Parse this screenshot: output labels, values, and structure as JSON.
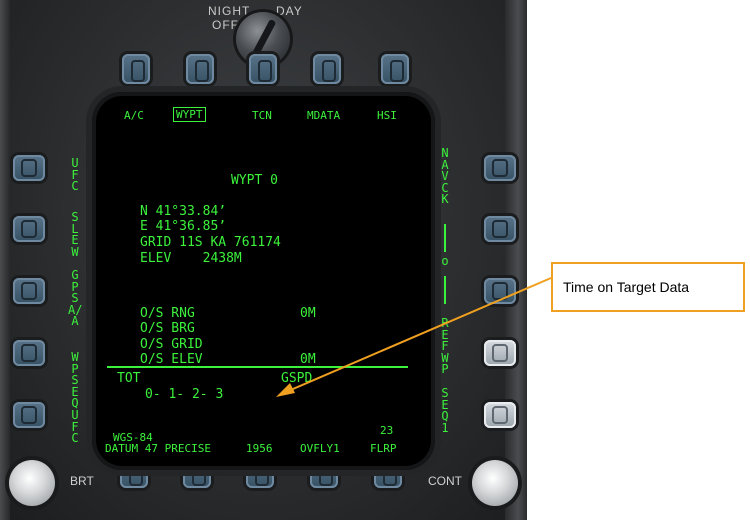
{
  "knob": {
    "night": "NIGHT",
    "day": "DAY",
    "off": "OFF"
  },
  "top_tabs": [
    "A/C",
    "WYPT",
    "TCN",
    "MDATA",
    "HSI"
  ],
  "left_labels": [
    "UFC",
    "SLEW",
    "GPS A/A",
    "WPSEQ",
    "UFC"
  ],
  "right_labels": {
    "nav_ck": "NAV CK",
    "o": "o",
    "ref_wp": "REF WP",
    "seq": "SEQ1"
  },
  "mfd": {
    "title": "WYPT 0",
    "lat": "N 41°33.84’",
    "lon": "E 41°36.85’",
    "grid": "GRID 11S KA 761174",
    "elev": "ELEV    2438M",
    "os_rng": "O/S RNG",
    "os_rng_val": "0M",
    "os_brg": "O/S BRG",
    "os_grid": "O/S GRID",
    "os_elev": "O/S ELEV",
    "os_elev_val": "0M",
    "tot": "TOT",
    "gspd": "GSPD",
    "tot_seq": "0- 1- 2- 3",
    "wgs": "WGS-84",
    "datum": "DATUM 47 PRECISE",
    "num_1956": "1956",
    "ovfly": "OVFLY1",
    "flrp": "FLRP",
    "num_23": "23"
  },
  "knob_labels": {
    "brt": "BRT",
    "cont": "CONT"
  },
  "callout": {
    "text": "Time on Target Data"
  },
  "colors": {
    "mfd_green": "#3cf23c",
    "callout_border": "#f0a020",
    "arrow": "#f0a020"
  }
}
